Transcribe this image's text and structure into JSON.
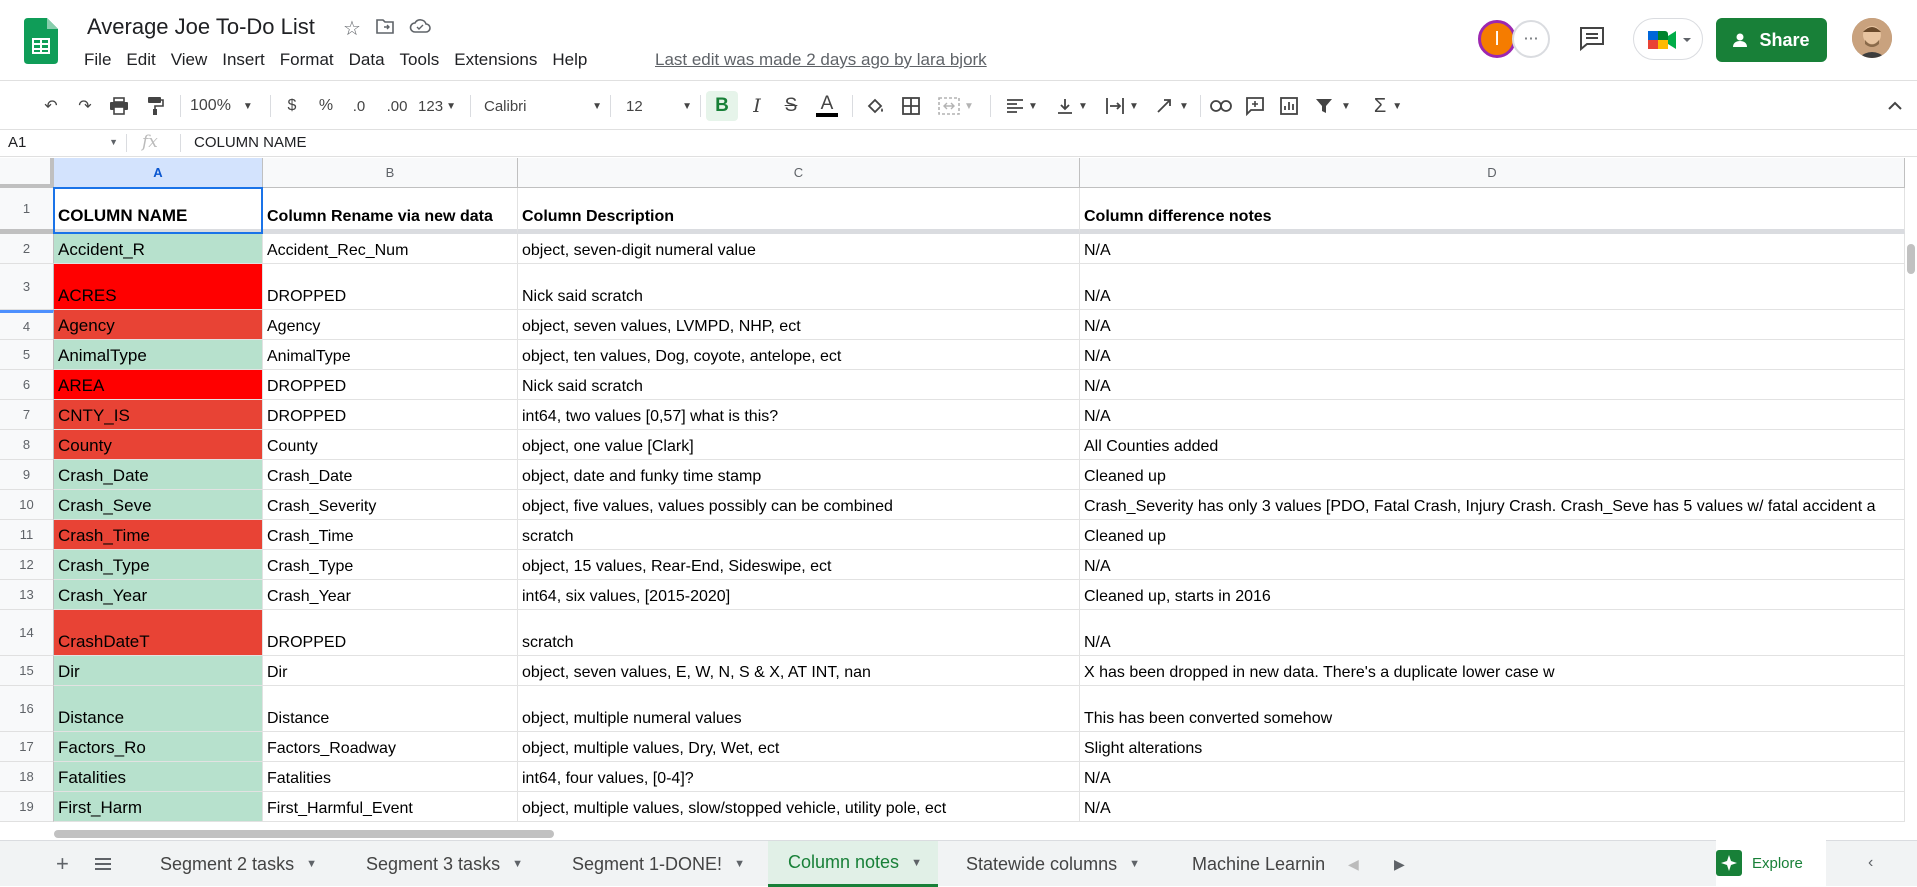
{
  "app": {
    "doc_title": "Average Joe To-Do List",
    "last_edit": "Last edit was made 2 days ago by lara bjork",
    "menu": [
      "File",
      "Edit",
      "View",
      "Insert",
      "Format",
      "Data",
      "Tools",
      "Extensions",
      "Help"
    ],
    "share_label": "Share",
    "avatar_initial": "I",
    "accent": "#188038"
  },
  "toolbar": {
    "zoom": "100%",
    "currency": "$",
    "percent": "%",
    "dec_less": ".0",
    "dec_more": ".00",
    "format_more": "123",
    "font": "Calibri",
    "font_size": "12",
    "bold": "B",
    "italic": "I",
    "strike": "S",
    "text_color": "A"
  },
  "formula_bar": {
    "cell_ref": "A1",
    "fx": "fx",
    "value": "COLUMN NAME"
  },
  "columns": [
    "A",
    "B",
    "C",
    "D"
  ],
  "rows": [
    {
      "num": "1",
      "a": "COLUMN NAME",
      "b": "Column Rename via new data",
      "c": "Column Description",
      "d": "Column difference notes",
      "color": "none",
      "header": true
    },
    {
      "num": "2",
      "a": "Accident_R",
      "b": "Accident_Rec_Num",
      "c": "object, seven-digit numeral value",
      "d": "N/A",
      "color": "#b7e1cd"
    },
    {
      "num": "3",
      "a": "ACRES",
      "b": "DROPPED",
      "c": "Nick said scratch",
      "d": "N/A",
      "color": "#ff0000"
    },
    {
      "num": "4",
      "a": "Agency",
      "b": "Agency",
      "c": "object, seven values, LVMPD, NHP, ect",
      "d": "N/A",
      "color": "#e84335"
    },
    {
      "num": "5",
      "a": "AnimalType",
      "b": "AnimalType",
      "c": "object, ten values, Dog, coyote, antelope, ect",
      "d": "N/A",
      "color": "#b7e1cd"
    },
    {
      "num": "6",
      "a": "AREA",
      "b": "DROPPED",
      "c": "Nick said scratch",
      "d": "N/A",
      "color": "#ff0000"
    },
    {
      "num": "7",
      "a": "CNTY_IS",
      "b": "DROPPED",
      "c": "int64, two values [0,57] what is this?",
      "d": "N/A",
      "color": "#e84335"
    },
    {
      "num": "8",
      "a": "County",
      "b": "County",
      "c": "object, one value [Clark]",
      "d": "All Counties added",
      "color": "#e84335"
    },
    {
      "num": "9",
      "a": "Crash_Date",
      "b": "Crash_Date",
      "c": "object, date and funky time stamp",
      "d": "Cleaned up",
      "color": "#b7e1cd"
    },
    {
      "num": "10",
      "a": "Crash_Seve",
      "b": "Crash_Severity",
      "c": "object, five values, values possibly can be combined",
      "d": "Crash_Severity has only 3 values [PDO, Fatal Crash, Injury Crash. Crash_Seve has 5 values w/ fatal accident a",
      "color": "#b7e1cd"
    },
    {
      "num": "11",
      "a": "Crash_Time",
      "b": "Crash_Time",
      "c": "scratch",
      "d": "Cleaned up",
      "color": "#e84335"
    },
    {
      "num": "12",
      "a": "Crash_Type",
      "b": "Crash_Type",
      "c": "object, 15 values, Rear-End, Sideswipe, ect",
      "d": "N/A",
      "color": "#b7e1cd"
    },
    {
      "num": "13",
      "a": "Crash_Year",
      "b": "Crash_Year",
      "c": "int64, six values, [2015-2020]",
      "d": "Cleaned up, starts in 2016",
      "color": "#b7e1cd"
    },
    {
      "num": "14",
      "a": "CrashDateT",
      "b": "DROPPED",
      "c": "scratch",
      "d": "N/A",
      "color": "#e84335"
    },
    {
      "num": "15",
      "a": "Dir",
      "b": "Dir",
      "c": "object, seven values, E, W, N, S & X, AT INT, nan",
      "d": "X has been dropped in new data. There's a duplicate lower case w",
      "color": "#b7e1cd"
    },
    {
      "num": "16",
      "a": "Distance",
      "b": "Distance",
      "c": "object, multiple numeral values",
      "d": "This has been converted somehow",
      "color": "#b7e1cd"
    },
    {
      "num": "17",
      "a": "Factors_Ro",
      "b": "Factors_Roadway",
      "c": "object, multiple values, Dry, Wet, ect",
      "d": "Slight alterations",
      "color": "#b7e1cd"
    },
    {
      "num": "18",
      "a": "Fatalities",
      "b": "Fatalities",
      "c": "int64, four values, [0-4]?",
      "d": "N/A",
      "color": "#b7e1cd"
    },
    {
      "num": "19",
      "a": "First_Harm",
      "b": "First_Harmful_Event",
      "c": "object, multiple values, slow/stopped vehicle, utility pole, ect",
      "d": "N/A",
      "color": "#b7e1cd"
    }
  ],
  "sheet_tabs": [
    "Segment 2 tasks",
    "Segment 3 tasks",
    "Segment 1-DONE!",
    "Column notes",
    "Statewide columns",
    "Machine Learnin"
  ],
  "active_tab": "Column notes",
  "explore_label": "Explore"
}
